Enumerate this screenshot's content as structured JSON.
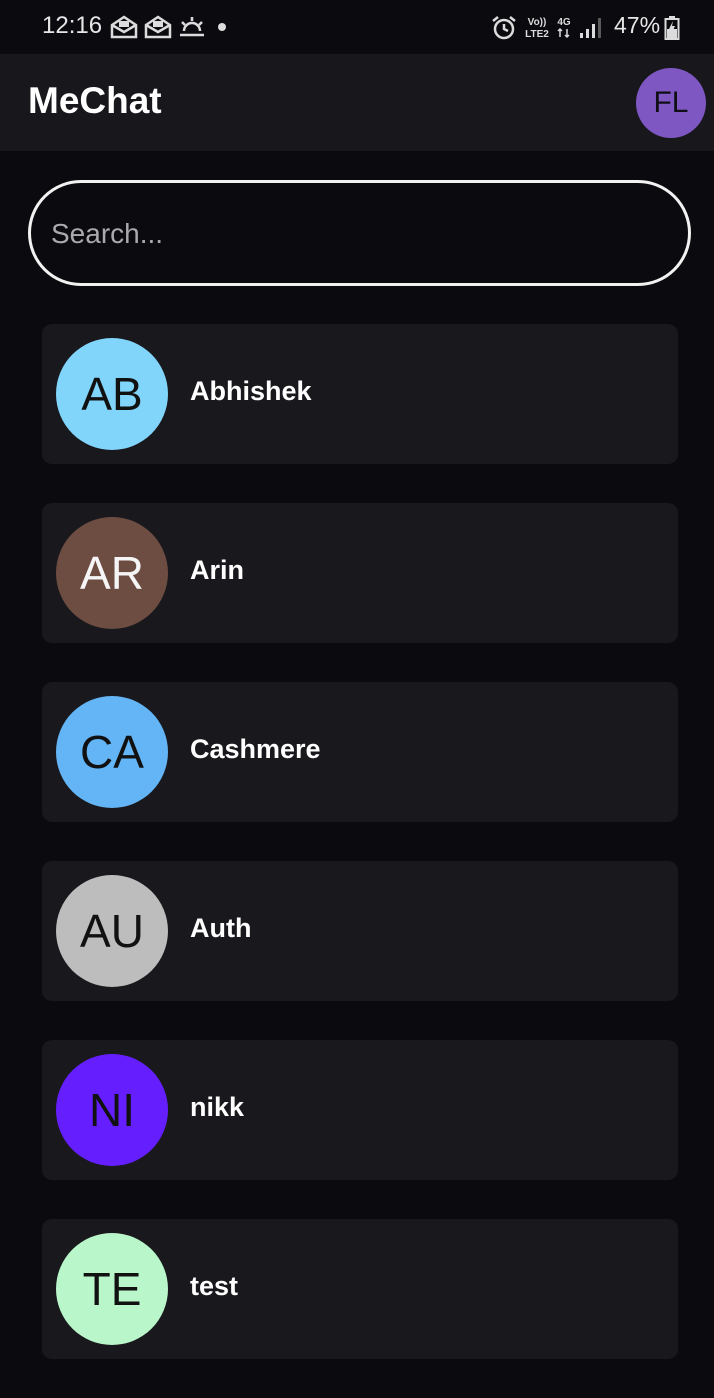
{
  "status_bar": {
    "time": "12:16",
    "icons": [
      "email-icon",
      "email-icon",
      "weather-icon",
      "alarm-icon",
      "volte-icon",
      "4g-icon",
      "signal-icon",
      "battery-charging-icon"
    ],
    "battery_percent": "47%"
  },
  "app_bar": {
    "title": "MeChat",
    "profile_initials": "FL",
    "profile_color": "#7e57c2"
  },
  "search": {
    "placeholder": "Search...",
    "value": ""
  },
  "contacts": [
    {
      "name": "Abhishek",
      "initials": "AB",
      "color": "#81d4fa",
      "text_color": "#111111"
    },
    {
      "name": "Arin",
      "initials": "AR",
      "color": "#6d4c41",
      "text_color": "#f5f5f5"
    },
    {
      "name": "Cashmere",
      "initials": "CA",
      "color": "#64b5f6",
      "text_color": "#111111"
    },
    {
      "name": "Auth",
      "initials": "AU",
      "color": "#bdbdbd",
      "text_color": "#111111"
    },
    {
      "name": "nikk",
      "initials": "NI",
      "color": "#651fff",
      "text_color": "#111111"
    },
    {
      "name": "test",
      "initials": "TE",
      "color": "#b9f6ca",
      "text_color": "#111111"
    }
  ],
  "colors": {
    "background": "#0b0b0f",
    "surface": "#19191d",
    "app_bar": "#18181c",
    "text": "#ffffff"
  }
}
